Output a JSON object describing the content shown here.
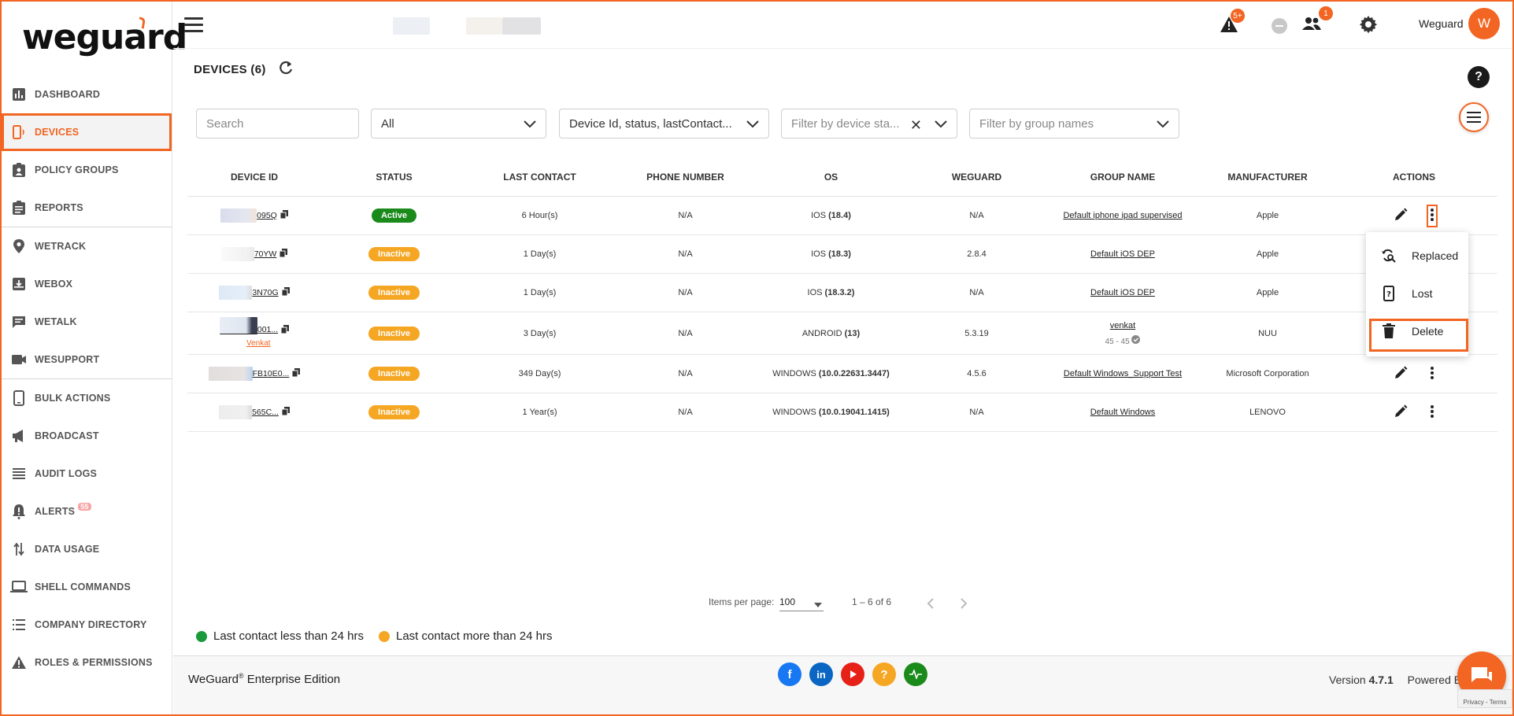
{
  "app": {
    "logo_text": "weguard",
    "user_name": "Weguard",
    "user_initial": "W"
  },
  "topbar": {
    "alerts_badge": "5+",
    "users_badge": "1"
  },
  "sidebar": {
    "items": [
      {
        "label": "DASHBOARD",
        "icon": "bar-chart-icon"
      },
      {
        "label": "DEVICES",
        "icon": "device-icon"
      },
      {
        "label": "POLICY GROUPS",
        "icon": "clipboard-user-icon"
      },
      {
        "label": "REPORTS",
        "icon": "clipboard-icon"
      },
      {
        "label": "WETRACK",
        "icon": "location-pin-icon"
      },
      {
        "label": "WEBOX",
        "icon": "inbox-download-icon"
      },
      {
        "label": "WETALK",
        "icon": "chat-icon"
      },
      {
        "label": "WESUPPORT",
        "icon": "video-camera-icon"
      },
      {
        "label": "BULK ACTIONS",
        "icon": "phone-icon"
      },
      {
        "label": "BROADCAST",
        "icon": "megaphone-icon"
      },
      {
        "label": "AUDIT LOGS",
        "icon": "list-icon"
      },
      {
        "label": "ALERTS",
        "icon": "alert-bell-icon",
        "badge": "55"
      },
      {
        "label": "DATA USAGE",
        "icon": "up-down-arrows-icon"
      },
      {
        "label": "SHELL COMMANDS",
        "icon": "laptop-icon"
      },
      {
        "label": "COMPANY DIRECTORY",
        "icon": "directory-list-icon"
      },
      {
        "label": "ROLES & PERMISSIONS",
        "icon": "warning-triangle-icon"
      }
    ]
  },
  "page": {
    "title": "DEVICES (6)"
  },
  "filters": {
    "search_placeholder": "Search",
    "type_value": "All",
    "columns_value": "Device Id, status, lastContact...",
    "device_status_placeholder": "Filter by device sta...",
    "group_placeholder": "Filter by group names"
  },
  "table": {
    "headers": [
      "DEVICE ID",
      "STATUS",
      "LAST CONTACT",
      "PHONE NUMBER",
      "OS",
      "WEGUARD",
      "GROUP NAME",
      "MANUFACTURER",
      "ACTIONS"
    ],
    "rows": [
      {
        "device_id": "095Q",
        "status": "Active",
        "last_contact": "6 Hour(s)",
        "phone": "N/A",
        "os_name": "IOS",
        "os_version": "(18.4)",
        "weguard": "N/A",
        "group": "Default iphone ipad supervised",
        "manufacturer": "Apple"
      },
      {
        "device_id": "70YW",
        "status": "Inactive",
        "last_contact": "1 Day(s)",
        "phone": "N/A",
        "os_name": "IOS",
        "os_version": "(18.3)",
        "weguard": "2.8.4",
        "group": "Default iOS DEP",
        "manufacturer": "Apple"
      },
      {
        "device_id": "3N70G",
        "status": "Inactive",
        "last_contact": "1 Day(s)",
        "phone": "N/A",
        "os_name": "IOS",
        "os_version": "(18.3.2)",
        "weguard": "N/A",
        "group": "Default iOS DEP",
        "manufacturer": "Apple"
      },
      {
        "device_id": "001...",
        "device_sub": "Venkat",
        "status": "Inactive",
        "last_contact": "3 Day(s)",
        "phone": "N/A",
        "os_name": "ANDROID",
        "os_version": "(13)",
        "weguard": "5.3.19",
        "group": "venkat",
        "group_sub": "45 - 45",
        "manufacturer": "NUU"
      },
      {
        "device_id": "FB10E0...",
        "status": "Inactive",
        "last_contact": "349 Day(s)",
        "phone": "N/A",
        "os_name": "WINDOWS",
        "os_version": "(10.0.22631.3447)",
        "weguard": "4.5.6",
        "group": "Default Windows_Support Test",
        "manufacturer": "Microsoft Corporation"
      },
      {
        "device_id": "565C...",
        "status": "Inactive",
        "last_contact": "1 Year(s)",
        "phone": "N/A",
        "os_name": "WINDOWS",
        "os_version": "(10.0.19041.1415)",
        "weguard": "N/A",
        "group": "Default Windows",
        "manufacturer": "LENOVO"
      }
    ]
  },
  "action_menu": {
    "items": [
      "Replaced",
      "Lost",
      "Delete"
    ]
  },
  "pagination": {
    "items_per_page_label": "Items per page:",
    "items_per_page": "100",
    "range": "1 – 6 of 6"
  },
  "legend": {
    "green": "Last contact less than 24 hrs",
    "orange": "Last contact more than 24 hrs"
  },
  "footer": {
    "brand": "WeGuard",
    "brand_sup": "®",
    "edition": " Enterprise Edition",
    "version_label": "Version ",
    "version": "4.7.1",
    "powered_by": "Powered By",
    "recaptcha": "Privacy - Terms"
  },
  "colors": {
    "accent": "#f26522",
    "active": "#1a8a1a",
    "inactive": "#f5a623"
  }
}
